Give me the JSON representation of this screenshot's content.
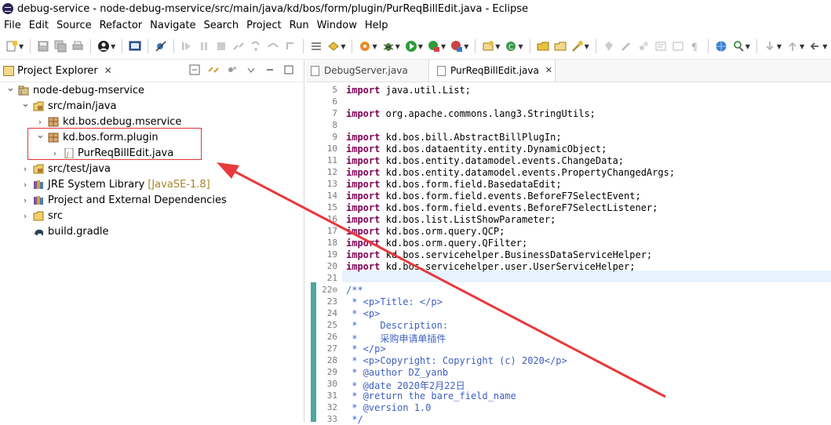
{
  "window": {
    "title": "debug-service - node-debug-mservice/src/main/java/kd/bos/form/plugin/PurReqBillEdit.java - Eclipse"
  },
  "menu": [
    "File",
    "Edit",
    "Source",
    "Refactor",
    "Navigate",
    "Search",
    "Project",
    "Run",
    "Window",
    "Help"
  ],
  "project_explorer": {
    "title": "Project Explorer",
    "close": "✕",
    "tree": [
      {
        "label": "node-debug-mservice",
        "decoration": "",
        "twisty": "⌄",
        "icon": "project-icon"
      },
      {
        "label": "src/main/java",
        "decoration": "",
        "twisty": "⌄",
        "icon": "source-folder-icon"
      },
      {
        "label": "kd.bos.debug.mservice",
        "decoration": "",
        "twisty": "›",
        "icon": "package-icon"
      },
      {
        "label": "kd.bos.form.plugin",
        "decoration": "",
        "twisty": "⌄",
        "icon": "package-icon"
      },
      {
        "label": "PurReqBillEdit.java",
        "decoration": "",
        "twisty": "›",
        "icon": "java-file-icon"
      },
      {
        "label": "src/test/java",
        "decoration": "",
        "twisty": "›",
        "icon": "source-folder-icon"
      },
      {
        "label": "JRE System Library",
        "decoration": "[JavaSE-1.8]",
        "twisty": "›",
        "icon": "library-icon"
      },
      {
        "label": "Project and External Dependencies",
        "decoration": "",
        "twisty": "›",
        "icon": "library-icon"
      },
      {
        "label": "src",
        "decoration": "",
        "twisty": "›",
        "icon": "folder-icon"
      },
      {
        "label": "build.gradle",
        "decoration": "",
        "twisty": "",
        "icon": "gradle-icon"
      }
    ]
  },
  "editor": {
    "tabs": [
      {
        "label": "DebugServer.java",
        "active": false
      },
      {
        "label": "PurReqBillEdit.java",
        "active": true,
        "close": "✕"
      }
    ],
    "lines": [
      {
        "n": "5",
        "tokens": [
          [
            "kw",
            "import"
          ],
          [
            "",
            "java.util.List;"
          ]
        ]
      },
      {
        "n": "6",
        "tokens": []
      },
      {
        "n": "7",
        "tokens": [
          [
            "kw",
            "import"
          ],
          [
            "",
            "org.apache.commons.lang3.StringUtils;"
          ]
        ]
      },
      {
        "n": "8",
        "tokens": []
      },
      {
        "n": "9",
        "tokens": [
          [
            "kw",
            "import"
          ],
          [
            "",
            "kd.bos.bill.AbstractBillPlugIn;"
          ]
        ]
      },
      {
        "n": "10",
        "tokens": [
          [
            "kw",
            "import"
          ],
          [
            "",
            "kd.bos.dataentity.entity.DynamicObject;"
          ]
        ]
      },
      {
        "n": "11",
        "tokens": [
          [
            "kw",
            "import"
          ],
          [
            "",
            "kd.bos.entity.datamodel.events.ChangeData;"
          ]
        ]
      },
      {
        "n": "12",
        "tokens": [
          [
            "kw",
            "import"
          ],
          [
            "",
            "kd.bos.entity.datamodel.events.PropertyChangedArgs;"
          ]
        ]
      },
      {
        "n": "13",
        "tokens": [
          [
            "kw",
            "import"
          ],
          [
            "",
            "kd.bos.form.field.BasedataEdit;"
          ]
        ]
      },
      {
        "n": "14",
        "tokens": [
          [
            "kw",
            "import"
          ],
          [
            "",
            "kd.bos.form.field.events.BeforeF7SelectEvent;"
          ]
        ]
      },
      {
        "n": "15",
        "tokens": [
          [
            "kw",
            "import"
          ],
          [
            "",
            "kd.bos.form.field.events.BeforeF7SelectListener;"
          ]
        ]
      },
      {
        "n": "16",
        "tokens": [
          [
            "kw",
            "import"
          ],
          [
            "",
            "kd.bos.list.ListShowParameter;"
          ]
        ]
      },
      {
        "n": "17",
        "tokens": [
          [
            "kw",
            "import"
          ],
          [
            "",
            "kd.bos.orm.query.QCP;"
          ]
        ]
      },
      {
        "n": "18",
        "tokens": [
          [
            "kw",
            "import"
          ],
          [
            "",
            "kd.bos.orm.query.QFilter;"
          ]
        ]
      },
      {
        "n": "19",
        "tokens": [
          [
            "kw",
            "import"
          ],
          [
            "",
            "kd.bos.servicehelper.BusinessDataServiceHelper;"
          ]
        ]
      },
      {
        "n": "20",
        "tokens": [
          [
            "kw",
            "import"
          ],
          [
            "",
            "kd.bos.servicehelper.user.UserServiceHelper;"
          ]
        ]
      },
      {
        "n": "21",
        "tokens": []
      },
      {
        "n": "22⊖",
        "tokens": [
          [
            "cm",
            "/**"
          ]
        ]
      },
      {
        "n": "23",
        "tokens": [
          [
            "cm",
            " * <p>Title: </p>"
          ]
        ]
      },
      {
        "n": "24",
        "tokens": [
          [
            "cm",
            " * <p>"
          ]
        ]
      },
      {
        "n": "25",
        "tokens": [
          [
            "cm",
            " *    Description:"
          ]
        ]
      },
      {
        "n": "26",
        "tokens": [
          [
            "cm",
            " *    采购申请单插件"
          ]
        ]
      },
      {
        "n": "27",
        "tokens": [
          [
            "cm",
            " * </p>"
          ]
        ]
      },
      {
        "n": "28",
        "tokens": [
          [
            "cm",
            " * <p>Copyright: Copyright (c) 2020</p>"
          ]
        ]
      },
      {
        "n": "29",
        "tokens": [
          [
            "cm",
            " * @author DZ_yanb"
          ]
        ]
      },
      {
        "n": "30",
        "tokens": [
          [
            "cm",
            " * @date 2020年2月22日"
          ]
        ]
      },
      {
        "n": "31",
        "tokens": [
          [
            "cm",
            " * @return the bare_field_name"
          ]
        ]
      },
      {
        "n": "32",
        "tokens": [
          [
            "cm",
            " * @version 1.0"
          ]
        ]
      },
      {
        "n": "33",
        "tokens": [
          [
            "cm",
            " */"
          ]
        ]
      }
    ]
  },
  "annotation": {
    "color": "#e8393c"
  }
}
